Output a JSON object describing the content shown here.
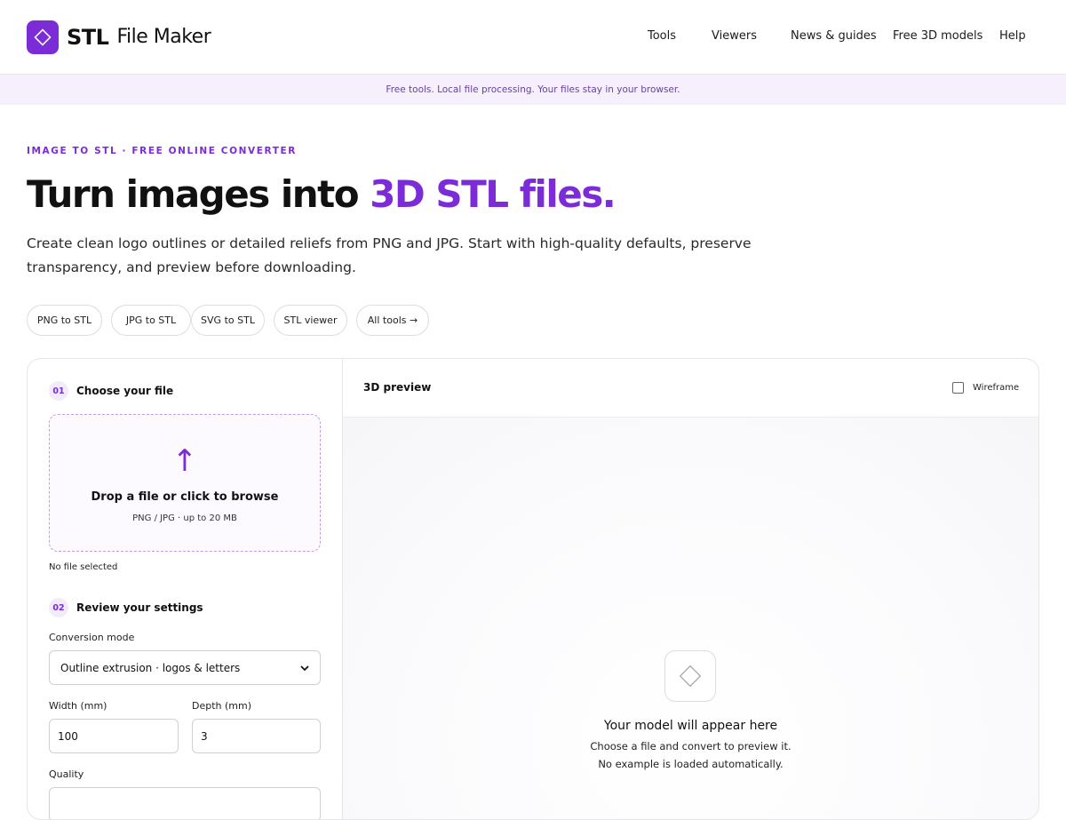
{
  "brand": {
    "name_bold": "STL",
    "name_light": "File Maker",
    "accent": "#7b2cd6"
  },
  "nav": [
    "Tools",
    "Viewers",
    "News & guides",
    "Free 3D models",
    "Help"
  ],
  "banner": "Free tools. Local file processing. Your files stay in your browser.",
  "hero": {
    "eyebrow": "IMAGE TO STL · FREE ONLINE CONVERTER",
    "title_main": "Turn images into ",
    "title_accent": "3D STL files.",
    "subtitle": "Create clean logo outlines or detailed reliefs from PNG and JPG. Start with high-quality defaults, preserve transparency, and preview before downloading."
  },
  "chips": [
    "PNG to STL",
    "JPG to STL",
    "SVG to STL",
    "STL viewer",
    "All tools →"
  ],
  "steps": {
    "step1": {
      "num": "01",
      "label": "Choose your file"
    },
    "step2": {
      "num": "02",
      "label": "Review your settings"
    }
  },
  "dropzone": {
    "title": "Drop a file or click to browse",
    "sub": "PNG / JPG · up to 20 MB",
    "status": "No file selected"
  },
  "settings": {
    "mode_label": "Conversion mode",
    "mode_value": "Outline extrusion · logos & letters",
    "width_label": "Width (mm)",
    "width_value": "100",
    "depth_label": "Depth (mm)",
    "depth_value": "3",
    "quality_label": "Quality"
  },
  "preview": {
    "title": "3D preview",
    "wireframe_label": "Wireframe",
    "placeholder_title": "Your model will appear here",
    "placeholder_line1": "Choose a file and convert to preview it.",
    "placeholder_line2": "No example is loaded automatically."
  }
}
